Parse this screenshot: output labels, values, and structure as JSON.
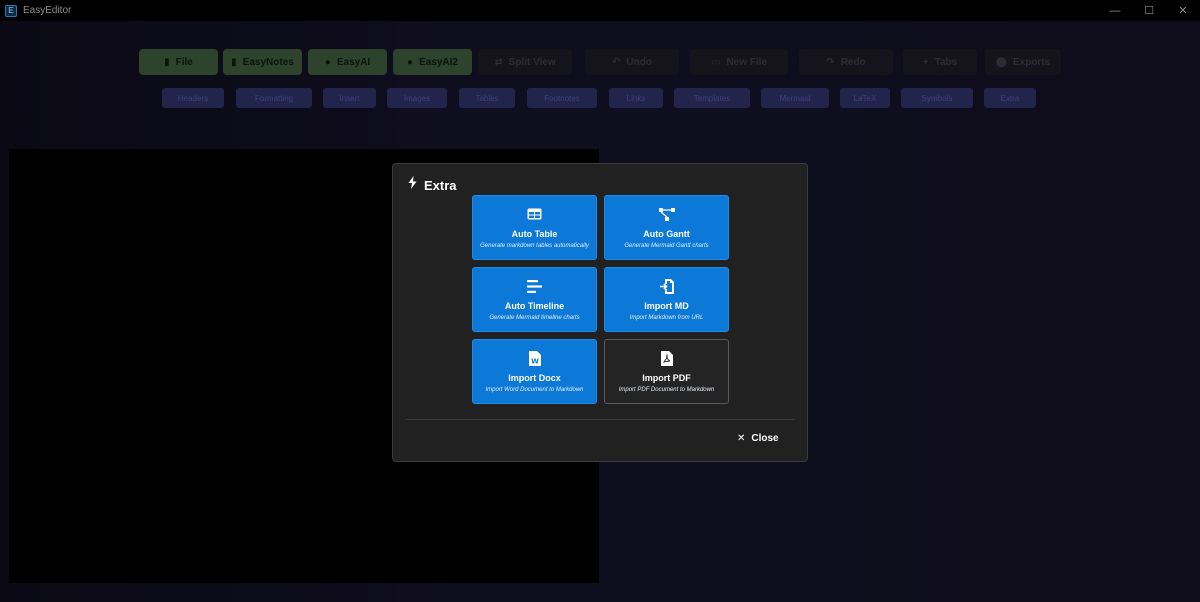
{
  "window": {
    "title": "EasyEditor",
    "icon_glyph": "E",
    "minimize_glyph": "—",
    "maximize_glyph": "☐",
    "close_glyph": "✕"
  },
  "toolbar": {
    "buttons": [
      {
        "label": "File",
        "icon": "file-icon",
        "style": "green"
      },
      {
        "label": "EasyNotes",
        "icon": "notes-icon",
        "style": "green"
      },
      {
        "label": "EasyAI",
        "icon": "ai-icon",
        "style": "green"
      },
      {
        "label": "EasyAI2",
        "icon": "ai-icon",
        "style": "green"
      },
      {
        "label": "Split View",
        "icon": "split-icon",
        "style": "dark"
      },
      {
        "label": "Undo",
        "icon": "undo-icon",
        "style": "dark"
      },
      {
        "label": "New File",
        "icon": "new-file-icon",
        "style": "dark"
      },
      {
        "label": "Redo",
        "icon": "redo-icon",
        "style": "dark"
      },
      {
        "label": "Tabs",
        "icon": "plus-icon",
        "style": "dark"
      },
      {
        "label": "Exports",
        "icon": "user-icon",
        "style": "dark"
      }
    ]
  },
  "tags": [
    "Headers",
    "Formatting",
    "Insert",
    "Images",
    "Tables",
    "Footnotes",
    "Links",
    "Templates",
    "Mermaid",
    "LaTeX",
    "Symbols",
    "Extra"
  ],
  "modal": {
    "title": "Extra",
    "title_icon": "lightning-icon",
    "cards": [
      {
        "title": "Auto Table",
        "desc": "Generate markdown tables automatically",
        "icon": "table-icon"
      },
      {
        "title": "Auto Gantt",
        "desc": "Generate Mermaid Gantt charts",
        "icon": "gantt-icon"
      },
      {
        "title": "Auto Timeline",
        "desc": "Generate Mermaid timeline charts",
        "icon": "timeline-icon"
      },
      {
        "title": "Import MD",
        "desc": "Import Markdown from URL",
        "icon": "import-icon"
      },
      {
        "title": "Import Docx",
        "desc": "Import Word Document to Markdown",
        "icon": "word-icon"
      },
      {
        "title": "Import PDF",
        "desc": "Import PDF Document to Markdown",
        "icon": "pdf-icon"
      }
    ],
    "close_label": "Close",
    "close_glyph": "✕"
  },
  "colors": {
    "card_primary": "#0c78d7",
    "card_alt": "#242424",
    "modal_bg": "#212121"
  }
}
